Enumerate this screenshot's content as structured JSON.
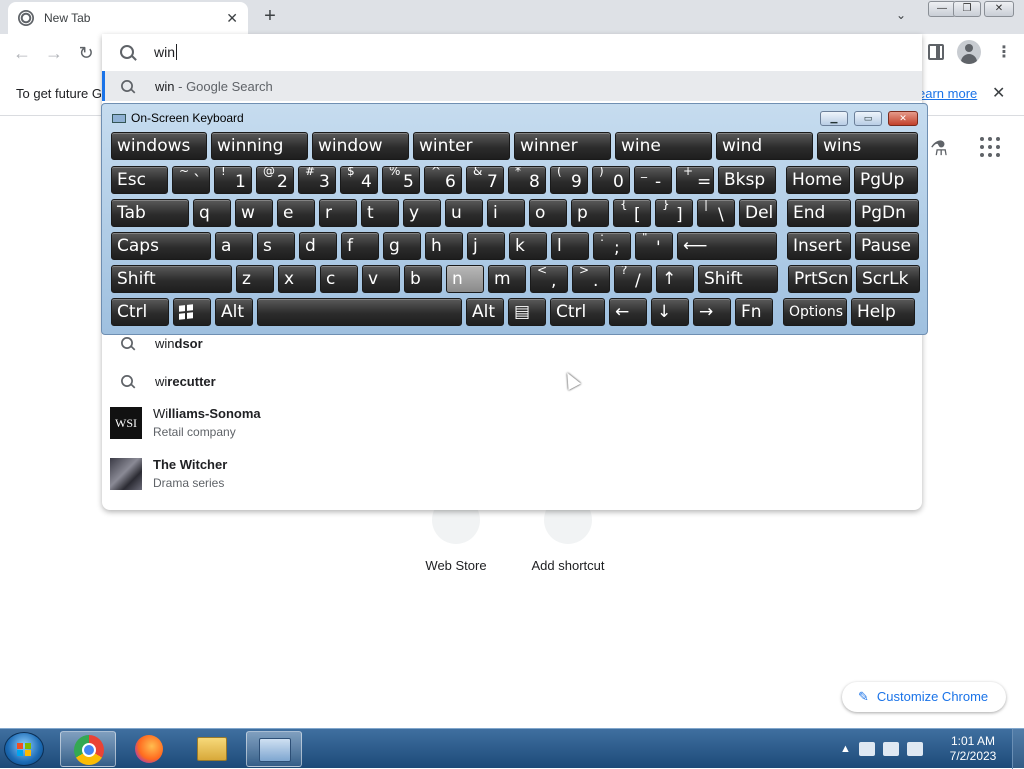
{
  "browser": {
    "tab_title": "New Tab",
    "tab_close": "✕",
    "new_tab": "+",
    "tab_search": "⌄",
    "back": "←",
    "forward": "→",
    "reload": "↻",
    "menu": "⋮",
    "window_controls": {
      "min": "—",
      "max": "❐",
      "close": "✕"
    }
  },
  "infobar": {
    "text": "To get future G",
    "link": "earn more",
    "close": "✕"
  },
  "omnibox": {
    "input": "win",
    "suggestions": [
      {
        "prefix": "win",
        "rest": " - Google Search",
        "icon": "search-icon"
      },
      {
        "prefix": "win",
        "rest": "dsor",
        "icon": "search-icon"
      },
      {
        "prefix": "wi",
        "rest": "recutter",
        "icon": "search-icon"
      }
    ],
    "entities": [
      {
        "prefix": "Wi",
        "rest": "lliams-Sonoma",
        "subtitle": "Retail company",
        "thumb": "WSI"
      },
      {
        "prefix": "The Wi",
        "rest": "tcher",
        "subtitle": "Drama series"
      }
    ]
  },
  "newtab": {
    "shortcuts": [
      {
        "label": "Web Store"
      },
      {
        "label": "Add shortcut"
      }
    ],
    "customize": "Customize Chrome"
  },
  "osk": {
    "title": "On-Screen Keyboard",
    "predictions": [
      "windows",
      "winning",
      "window",
      "winter",
      "winner",
      "wine",
      "wind",
      "wins"
    ],
    "row1": [
      {
        "k": "Esc"
      },
      {
        "s": "~",
        "l": "`"
      },
      {
        "s": "!",
        "l": "1"
      },
      {
        "s": "@",
        "l": "2"
      },
      {
        "s": "#",
        "l": "3"
      },
      {
        "s": "$",
        "l": "4"
      },
      {
        "s": "%",
        "l": "5"
      },
      {
        "s": "^",
        "l": "6"
      },
      {
        "s": "&",
        "l": "7"
      },
      {
        "s": "*",
        "l": "8"
      },
      {
        "s": "(",
        "l": "9"
      },
      {
        "s": ")",
        "l": "0"
      },
      {
        "s": "_",
        "l": "-"
      },
      {
        "s": "+",
        "l": "="
      },
      {
        "k": "Bksp"
      },
      {
        "k": "Home"
      },
      {
        "k": "PgUp"
      }
    ],
    "row2": [
      {
        "k": "Tab"
      },
      {
        "k": "q"
      },
      {
        "k": "w"
      },
      {
        "k": "e"
      },
      {
        "k": "r"
      },
      {
        "k": "t"
      },
      {
        "k": "y"
      },
      {
        "k": "u"
      },
      {
        "k": "i"
      },
      {
        "k": "o"
      },
      {
        "k": "p"
      },
      {
        "s": "{",
        "l": "["
      },
      {
        "s": "}",
        "l": "]"
      },
      {
        "s": "|",
        "l": "\\"
      },
      {
        "k": "Del"
      },
      {
        "k": "End"
      },
      {
        "k": "PgDn"
      }
    ],
    "row3": [
      {
        "k": "Caps"
      },
      {
        "k": "a"
      },
      {
        "k": "s"
      },
      {
        "k": "d"
      },
      {
        "k": "f"
      },
      {
        "k": "g"
      },
      {
        "k": "h"
      },
      {
        "k": "j"
      },
      {
        "k": "k"
      },
      {
        "k": "l"
      },
      {
        "s": ":",
        "l": ";"
      },
      {
        "s": "\"",
        "l": "'"
      },
      {
        "k": "⟵"
      },
      {
        "k": "Insert"
      },
      {
        "k": "Pause"
      }
    ],
    "row4": [
      {
        "k": "Shift"
      },
      {
        "k": "z"
      },
      {
        "k": "x"
      },
      {
        "k": "c"
      },
      {
        "k": "v"
      },
      {
        "k": "b"
      },
      {
        "k": "n"
      },
      {
        "k": "m"
      },
      {
        "s": "<",
        "l": ","
      },
      {
        "s": ">",
        "l": "."
      },
      {
        "s": "?",
        "l": "/"
      },
      {
        "k": "↑"
      },
      {
        "k": "Shift"
      },
      {
        "k": "PrtScn"
      },
      {
        "k": "ScrLk"
      }
    ],
    "row5": [
      {
        "k": "Ctrl"
      },
      {
        "k": "win-logo"
      },
      {
        "k": "Alt"
      },
      {
        "k": ""
      },
      {
        "k": "Alt"
      },
      {
        "k": "▤"
      },
      {
        "k": "Ctrl"
      },
      {
        "k": "←"
      },
      {
        "k": "↓"
      },
      {
        "k": "→"
      },
      {
        "k": "Fn"
      },
      {
        "k": "Options"
      },
      {
        "k": "Help"
      }
    ],
    "hover_key": "n"
  },
  "taskbar": {
    "apps": [
      "chrome-icon",
      "firefox-icon",
      "explorer-icon",
      "osk-icon"
    ],
    "tray_arrow": "▲",
    "time": "1:01 AM",
    "date": "7/2/2023"
  },
  "colors": {
    "accent": "#1a73e8",
    "taskbar": "#1d4a78",
    "osk_bg": "#b3cfe8",
    "key": "#2c2c2c"
  }
}
